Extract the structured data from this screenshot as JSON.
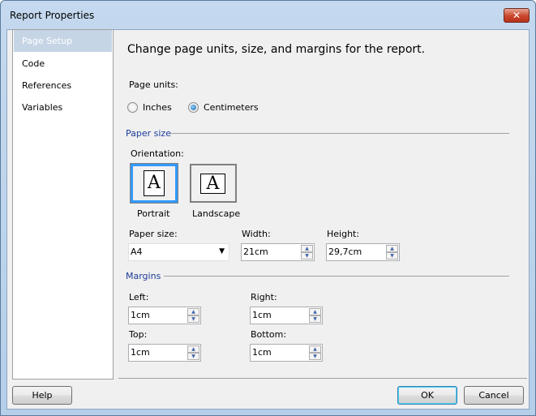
{
  "window": {
    "title": "Report Properties",
    "close_icon": "close-icon"
  },
  "sidebar": {
    "items": [
      {
        "label": "Page Setup",
        "selected": true
      },
      {
        "label": "Code"
      },
      {
        "label": "References"
      },
      {
        "label": "Variables"
      }
    ]
  },
  "main": {
    "heading": "Change page units, size, and margins for the report.",
    "page_units": {
      "label": "Page units:",
      "options": [
        {
          "label": "Inches",
          "checked": false
        },
        {
          "label": "Centimeters",
          "checked": true
        }
      ]
    },
    "paper_size_group": {
      "title": "Paper size",
      "orientation_label": "Orientation:",
      "orientations": [
        {
          "label": "Portrait",
          "selected": true,
          "glyph": "A"
        },
        {
          "label": "Landscape",
          "selected": false,
          "glyph": "A"
        }
      ],
      "paper_size_label": "Paper size:",
      "paper_size_value": "A4",
      "width_label": "Width:",
      "width_value": "21cm",
      "height_label": "Height:",
      "height_value": "29,7cm"
    },
    "margins_group": {
      "title": "Margins",
      "left_label": "Left:",
      "left_value": "1cm",
      "right_label": "Right:",
      "right_value": "1cm",
      "top_label": "Top:",
      "top_value": "1cm",
      "bottom_label": "Bottom:",
      "bottom_value": "1cm"
    }
  },
  "footer": {
    "help": "Help",
    "ok": "OK",
    "cancel": "Cancel"
  }
}
